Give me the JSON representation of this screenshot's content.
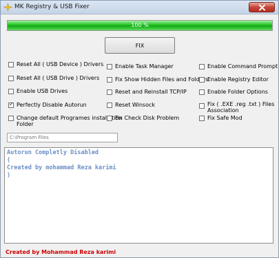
{
  "window": {
    "title": "MK Registry & USB Fixer",
    "app_icon": "sparkle-icon",
    "close_icon": "close-icon"
  },
  "progress": {
    "value_percent": 100,
    "label": "100 %",
    "color": "#22c023"
  },
  "fix_button": {
    "label": "FIX"
  },
  "options": {
    "col1": [
      {
        "label": "Reset All ( USB Device ) Drivers",
        "checked": false
      },
      {
        "label": "Reset All ( USB Drive ) Drivers",
        "checked": false
      },
      {
        "label": "Enable USB Drives",
        "checked": false
      },
      {
        "label": "Perfectly Disable Autorun",
        "checked": true
      },
      {
        "label": "Change default Programes installation",
        "label2": "Folder",
        "checked": false
      }
    ],
    "col2": [
      {
        "label": "Enable Task Manager",
        "checked": false
      },
      {
        "label": "Fix Show Hidden Files and Folders",
        "checked": false
      },
      {
        "label": "Reset and Reinstall TCP/IP",
        "checked": false
      },
      {
        "label": "Reset Winsock",
        "checked": false
      },
      {
        "label": "Fix Check Disk Problem",
        "checked": false
      }
    ],
    "col3": [
      {
        "label": "Enable Command Prompt",
        "checked": false
      },
      {
        "label": "Enable Registry Editor",
        "checked": false
      },
      {
        "label": "Enable Folder Options",
        "checked": false
      },
      {
        "label": "Fix  ( .EXE  .reg  .txt )  Files",
        "label2": "Association",
        "checked": false
      },
      {
        "label": "Fix Safe Mod",
        "checked": false
      }
    ]
  },
  "install_path": {
    "value": "C:\\Program Files"
  },
  "log": {
    "lines": [
      "Autorun Completly Disabled",
      "(",
      "Created by mohammad Reza karimi",
      ")"
    ],
    "color": "#6b8fc6"
  },
  "footer": {
    "text": "Created by Mohammad Reza karimi",
    "color": "#cc0000"
  }
}
